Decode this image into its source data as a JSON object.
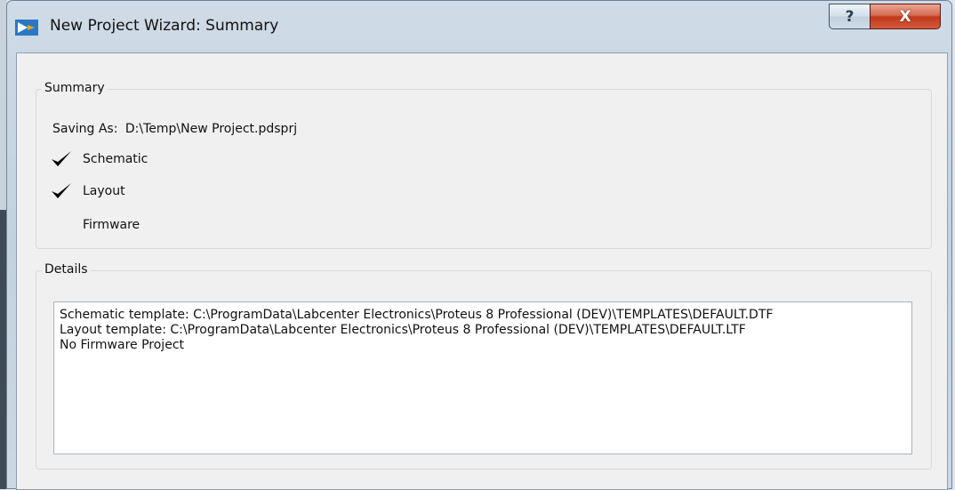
{
  "window": {
    "title": "New Project Wizard: Summary",
    "help_label": "?",
    "close_label": "X"
  },
  "summary": {
    "group_label": "Summary",
    "saving_as_label": "Saving As:",
    "saving_as_path": "D:\\Temp\\New Project.pdsprj",
    "items": [
      {
        "label": "Schematic",
        "checked": true
      },
      {
        "label": "Layout",
        "checked": true
      },
      {
        "label": "Firmware",
        "checked": false
      }
    ]
  },
  "details": {
    "group_label": "Details",
    "lines": [
      "Schematic template: C:\\ProgramData\\Labcenter Electronics\\Proteus 8 Professional (DEV)\\TEMPLATES\\DEFAULT.DTF",
      "Layout template: C:\\ProgramData\\Labcenter Electronics\\Proteus 8 Professional (DEV)\\TEMPLATES\\DEFAULT.LTF",
      "No Firmware Project"
    ]
  },
  "colors": {
    "titlebar": "#c3d2df",
    "close_button": "#c2391c",
    "dialog_background": "#f0f0f0"
  }
}
